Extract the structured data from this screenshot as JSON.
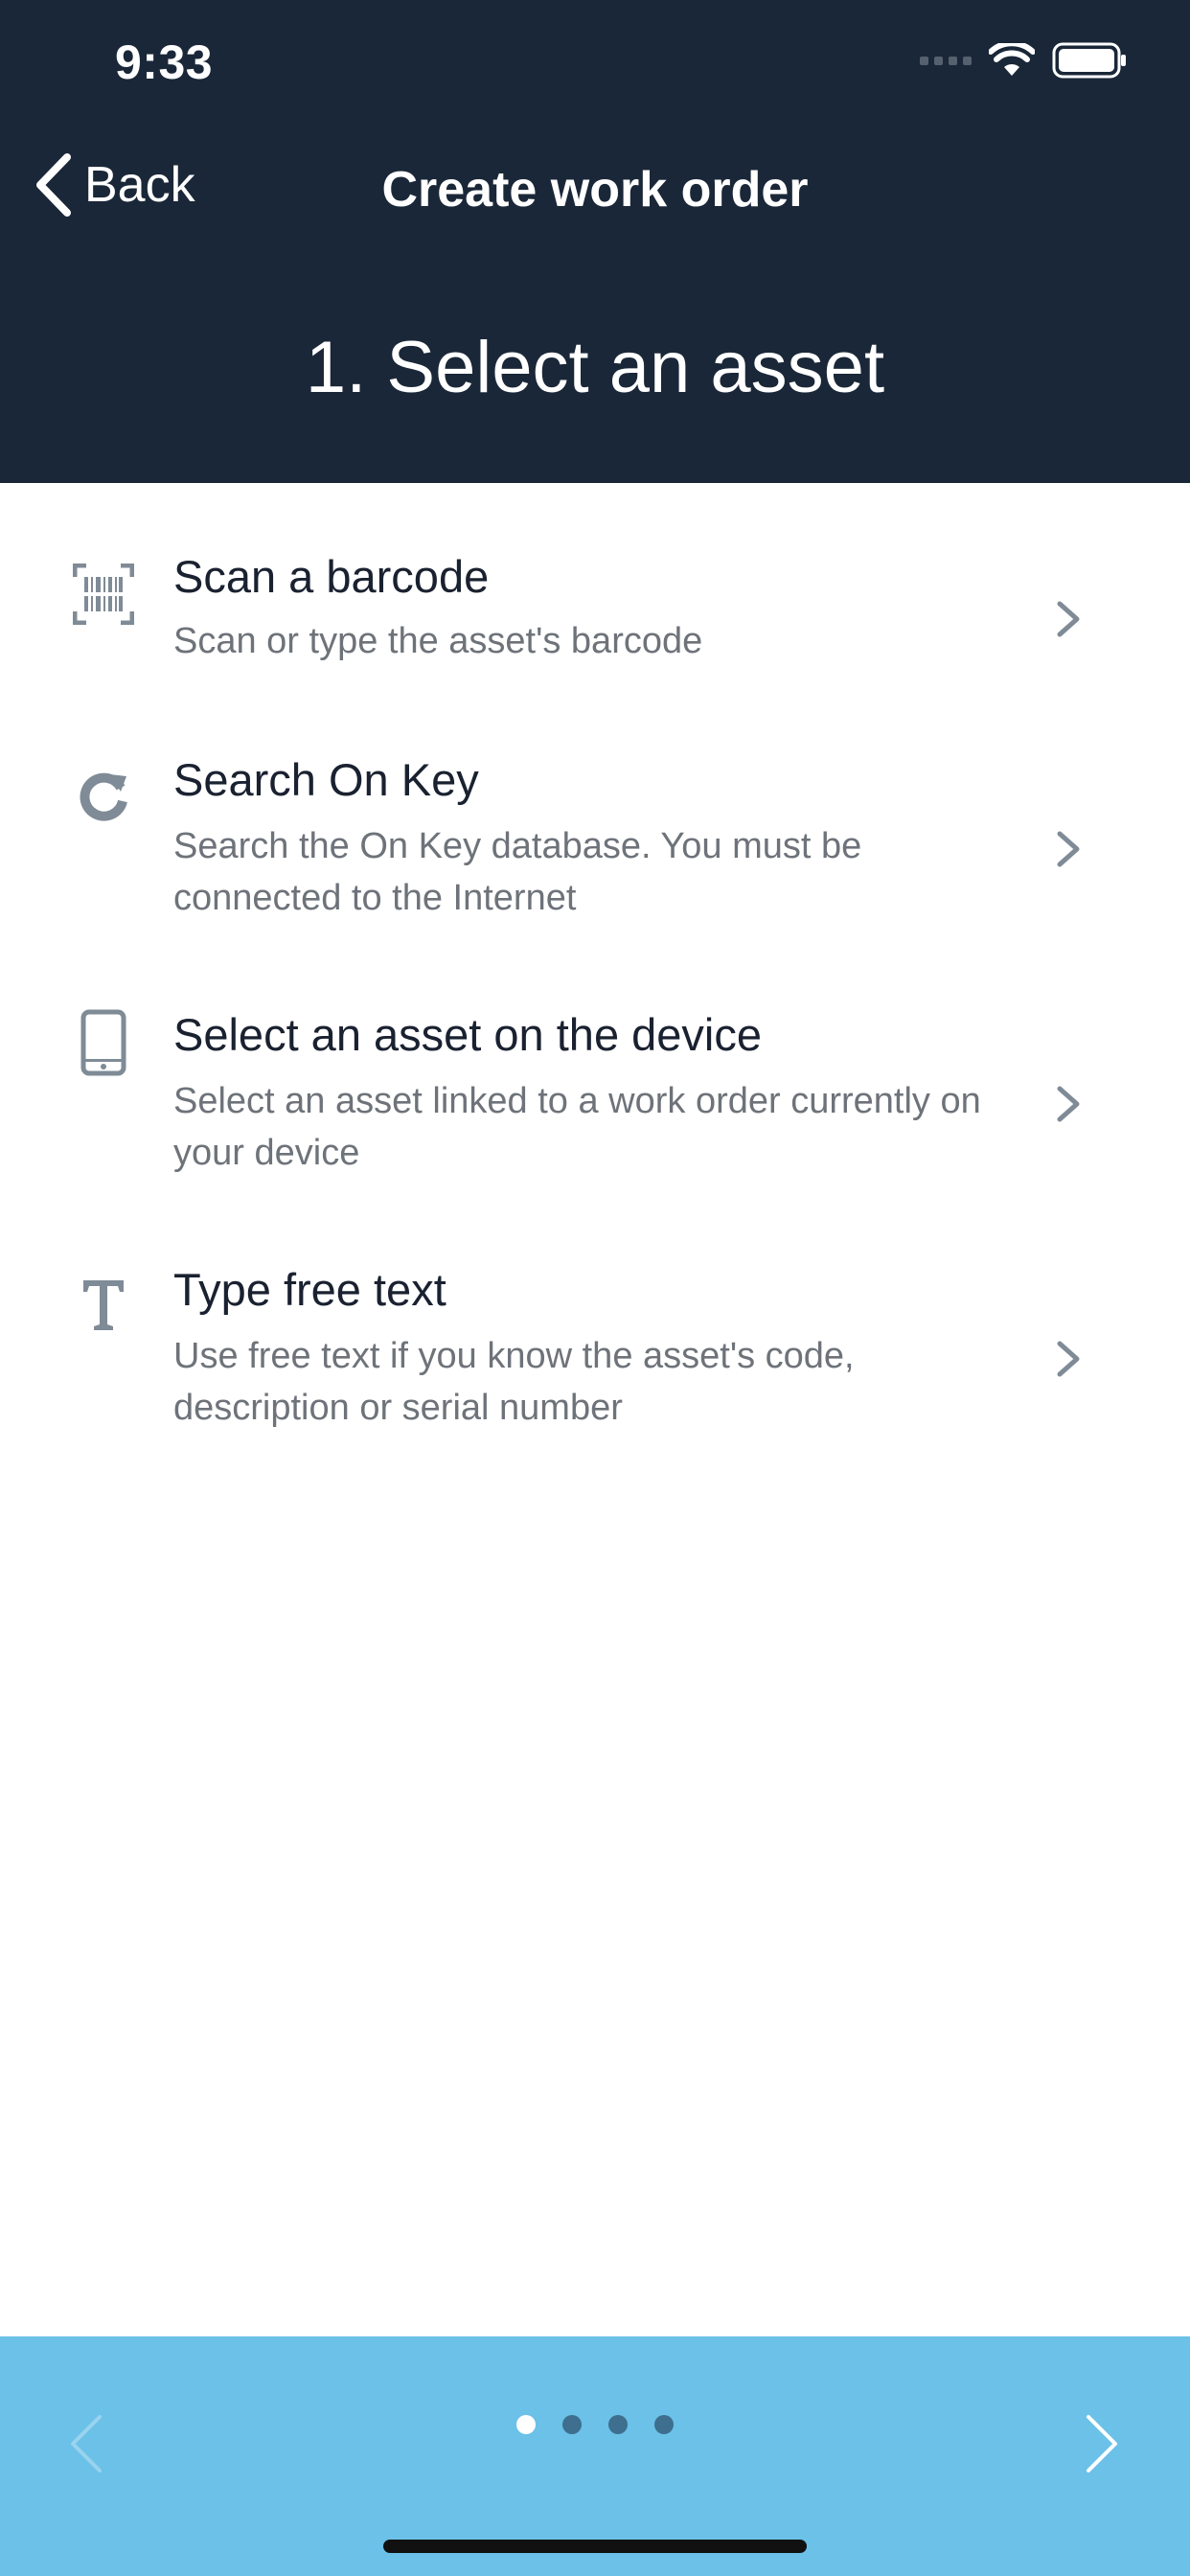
{
  "status_bar": {
    "time": "9:33"
  },
  "nav": {
    "back_label": "Back",
    "title": "Create work order"
  },
  "step_title": "1. Select an asset",
  "options": [
    {
      "icon": "barcode-icon",
      "title": "Scan a barcode",
      "description": "Scan or type the asset's barcode"
    },
    {
      "icon": "refresh-search-icon",
      "title": "Search On Key",
      "description": "Search the On Key database. You must be connected to the Internet"
    },
    {
      "icon": "phone-device-icon",
      "title": "Select an asset on the device",
      "description": "Select an asset linked to a work order currently on your device"
    },
    {
      "icon": "text-icon",
      "title": "Type free text",
      "description": "Use free text if you know the asset's code, description or serial number"
    }
  ],
  "pager": {
    "total_pages": 4,
    "current_page": 1
  },
  "colors": {
    "header_bg": "#1a2738",
    "footer_bg": "#6bc1e8",
    "icon_gray": "#7f8b96"
  }
}
